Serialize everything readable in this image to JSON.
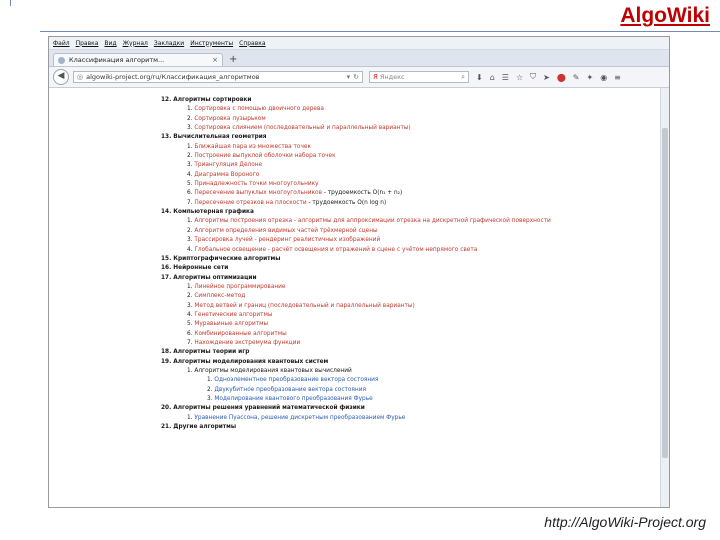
{
  "slide": {
    "title": "AlgoWiki",
    "footer": "http://AlgoWiki-Project.org"
  },
  "browser": {
    "menu": [
      "Файл",
      "Правка",
      "Вид",
      "Журнал",
      "Закладки",
      "Инструменты",
      "Справка"
    ],
    "tab_title": "Классификация алгоритм...",
    "url": "algowiki-project.org/ru/Классификация_алгоритмов",
    "search_placeholder": "Яндекс"
  },
  "content": {
    "lines": [
      {
        "kind": "section",
        "text": "12. Алгоритмы сортировки"
      },
      {
        "kind": "item",
        "num": "1.",
        "text": "Сортировка с помощью двоичного дерева"
      },
      {
        "kind": "item",
        "num": "2.",
        "text": "Сортировка пузырьком"
      },
      {
        "kind": "item",
        "num": "3.",
        "text": "Сортировка слиянием (последовательный и параллельный варианты)"
      },
      {
        "kind": "section",
        "text": "13. Вычислительная геометрия"
      },
      {
        "kind": "item",
        "num": "1.",
        "text": "Ближайшая пара из множества точек"
      },
      {
        "kind": "item",
        "num": "2.",
        "text": "Построение выпуклой оболочки набора точек"
      },
      {
        "kind": "item",
        "num": "3.",
        "text": "Триангуляция Делоне"
      },
      {
        "kind": "item",
        "num": "4.",
        "text": "Диаграмма Вороного"
      },
      {
        "kind": "item",
        "num": "5.",
        "text": "Принадлежность точки многоугольнику"
      },
      {
        "kind": "item",
        "num": "6.",
        "text": "Пересечение выпуклых многоугольников",
        "suffix": " - трудоемкость O(n₁ + n₂)"
      },
      {
        "kind": "item",
        "num": "7.",
        "text": "Пересечение отрезков на плоскости",
        "suffix": " - трудоемкость O(n log n)"
      },
      {
        "kind": "section",
        "text": "14. Компьютерная графика"
      },
      {
        "kind": "item",
        "num": "1.",
        "text": "Алгоритмы построения отрезка - алгоритмы для аппроксимации отрезка на дискретной графической поверхности"
      },
      {
        "kind": "item",
        "num": "2.",
        "text": "Алгоритм определения видимых частей трёхмерной сцены"
      },
      {
        "kind": "item",
        "num": "3.",
        "text": "Трассировка лучей - рендеринг реалистичных изображений"
      },
      {
        "kind": "item",
        "num": "4.",
        "text": "Глобальное освещение - расчёт освещения и отражений в сцене с учётом непрямого света"
      },
      {
        "kind": "section",
        "text": "15. Криптографические алгоритмы"
      },
      {
        "kind": "section",
        "text": "16. Нейронные сети"
      },
      {
        "kind": "section",
        "text": "17. Алгоритмы оптимизации"
      },
      {
        "kind": "item",
        "num": "1.",
        "text": "Линейное программирование"
      },
      {
        "kind": "item",
        "num": "2.",
        "text": "Симплекс-метод"
      },
      {
        "kind": "item",
        "num": "3.",
        "text": "Метод ветвей и границ (последовательный и параллельный варианты)"
      },
      {
        "kind": "item",
        "num": "4.",
        "text": "Генетические алгоритмы"
      },
      {
        "kind": "item",
        "num": "5.",
        "text": "Муравьиные алгоритмы"
      },
      {
        "kind": "item",
        "num": "6.",
        "text": "Комбинированные алгоритмы"
      },
      {
        "kind": "item",
        "num": "7.",
        "text": "Нахождение экстремума функции"
      },
      {
        "kind": "section",
        "text": "18. Алгоритмы теории игр"
      },
      {
        "kind": "section",
        "text": "19. Алгоритмы моделирования квантовых систем"
      },
      {
        "kind": "item",
        "num": "1.",
        "text": "Алгоритмы моделирования квантовых вычислений",
        "plain": true
      },
      {
        "kind": "sub",
        "num": "1.",
        "text": "Одноэлементное преобразование вектора состояния"
      },
      {
        "kind": "sub",
        "num": "2.",
        "text": "Двукубитное преобразование вектора состояния"
      },
      {
        "kind": "sub",
        "num": "3.",
        "text": "Моделирование квантового преобразования Фурье"
      },
      {
        "kind": "section",
        "text": "20. Алгоритмы решения уравнений математической физики"
      },
      {
        "kind": "item",
        "num": "1.",
        "text": "Уравнение Пуассона, решение дискретным преобразованием Фурье",
        "blue": true
      },
      {
        "kind": "section",
        "text": "21. Другие алгоритмы"
      }
    ]
  }
}
